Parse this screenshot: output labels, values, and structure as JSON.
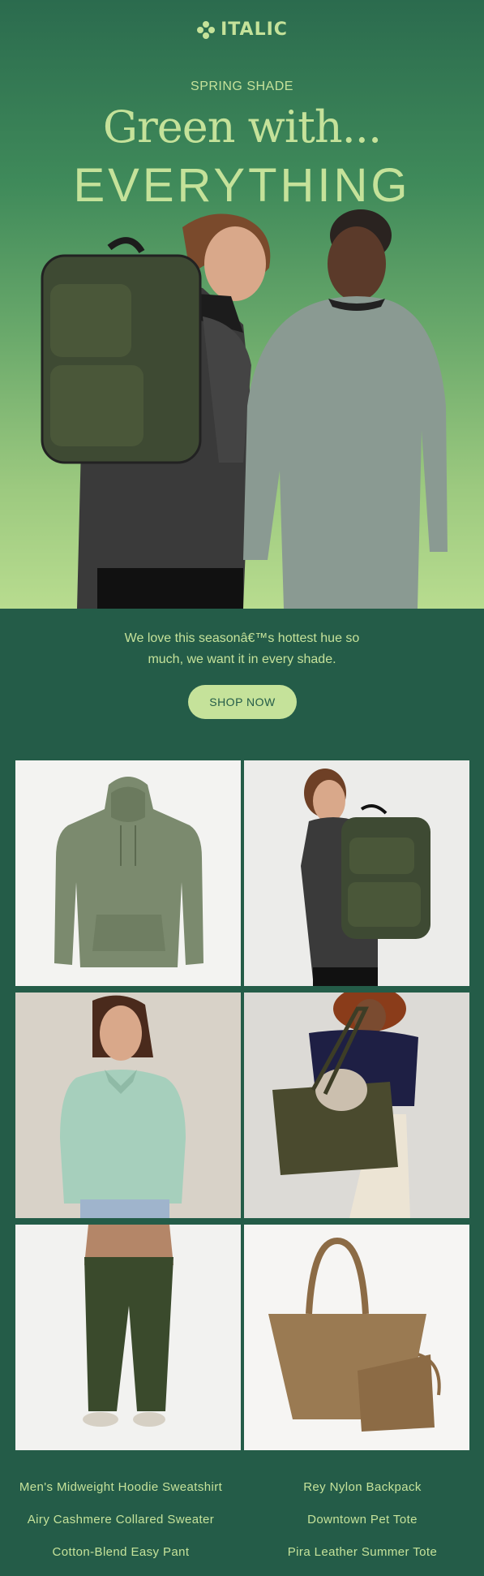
{
  "brand": {
    "logo_text": "ITALIC"
  },
  "hero": {
    "eyebrow": "SPRING SHADE",
    "headline_line1": "Green with...",
    "headline_line2": "EVERYTHING"
  },
  "intro": {
    "text": "We love this seasonâ€™s hottest hue so much, we want it in every shade.",
    "cta_label": "SHOP NOW"
  },
  "products": [
    {
      "name": "Men's Midweight Hoodie Sweatshirt"
    },
    {
      "name": "Rey Nylon Backpack"
    },
    {
      "name": "Airy Cashmere Collared Sweater"
    },
    {
      "name": "Downtown Pet Tote"
    },
    {
      "name": "Cotton-Blend Easy Pant"
    },
    {
      "name": "Pira Leather Summer Tote"
    }
  ],
  "colors": {
    "background": "#245c48",
    "accent": "#c5e29a"
  }
}
